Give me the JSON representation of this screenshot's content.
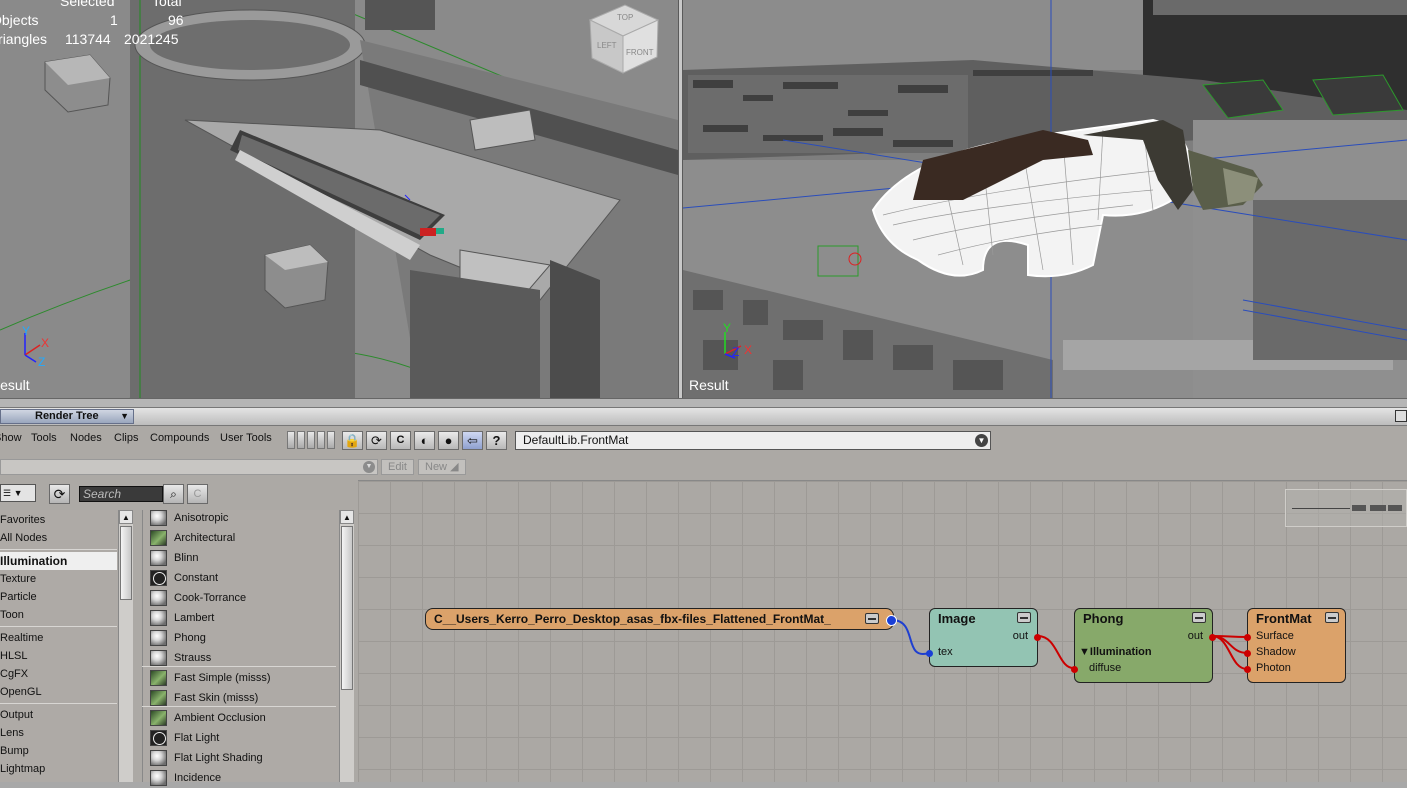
{
  "viewports": {
    "left": {
      "label": "Result",
      "stats": {
        "col_selected": "Selected",
        "col_total": "Total",
        "objects_label": "Objects",
        "objects_selected": "1",
        "objects_total": "96",
        "triangles_label": "Triangles",
        "triangles_selected": "113744",
        "triangles_total": "2021245"
      },
      "axis": {
        "x": "X",
        "y": "Y",
        "z": "Z"
      },
      "cube_faces": {
        "top": "TOP",
        "left": "LEFT",
        "front": "FRONT"
      }
    },
    "right": {
      "label": "Result",
      "axis": {
        "x": "X",
        "y": "Y",
        "z": "Z"
      }
    }
  },
  "render_tree": {
    "title": "Render Tree",
    "menu": [
      "Show",
      "Tools",
      "Nodes",
      "Clips",
      "Compounds",
      "User Tools"
    ],
    "toolbar_icons": [
      "lock-icon",
      "refresh-icon",
      "copy-icon",
      "globe-icon",
      "sphere-icon",
      "back-arrow-icon",
      "help-icon"
    ],
    "material_selector": "DefaultLib.FrontMat",
    "edit_label": "Edit",
    "new_label": "New",
    "search_placeholder": "Search",
    "categories": [
      "Favorites",
      "All Nodes",
      "Illumination",
      "Texture",
      "Particle",
      "Toon",
      "Realtime",
      "HLSL",
      "CgFX",
      "OpenGL",
      "Output",
      "Lens",
      "Bump",
      "Lightmap"
    ],
    "selected_category": "Illumination",
    "nodes": [
      "Anisotropic",
      "Architectural",
      "Blinn",
      "Constant",
      "Cook-Torrance",
      "Lambert",
      "Phong",
      "Strauss",
      "Fast Simple (misss)",
      "Fast Skin (misss)",
      "Ambient Occlusion",
      "Flat Light",
      "Flat Light Shading",
      "Incidence"
    ],
    "graph": {
      "image_clip": {
        "title": "C__Users_Kerro_Perro_Desktop_asas_fbx-files_Flattened_FrontMat_",
        "color": "#dba26a"
      },
      "image": {
        "title": "Image",
        "in": "tex",
        "out": "out",
        "color": "#93c4b3"
      },
      "phong": {
        "title": "Phong",
        "out": "out",
        "group": "Illumination",
        "in": "diffuse",
        "color": "#87a96a"
      },
      "material": {
        "title": "FrontMat",
        "inputs": [
          "Surface",
          "Shadow",
          "Photon"
        ],
        "color": "#dba26a"
      }
    }
  }
}
